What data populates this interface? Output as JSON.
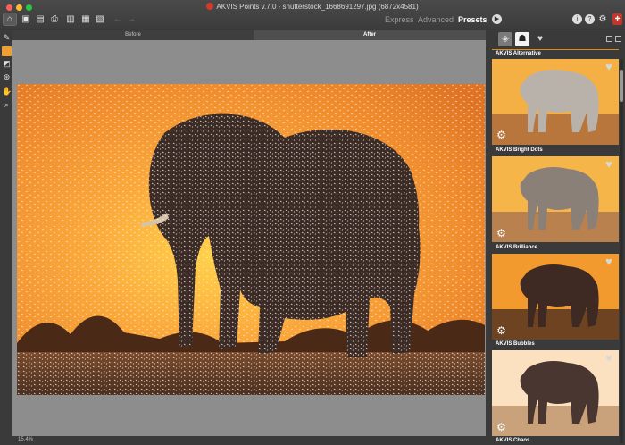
{
  "window": {
    "title": "AKVIS Points v.7.0 - shutterstock_1668691297.jpg (6872x4581)"
  },
  "toolbar": {
    "left_icons": [
      "home-icon",
      "open-file-icon",
      "save-file-icon",
      "print-icon",
      "batch-icon",
      "share-icon",
      "preferences-icon",
      "undo-icon",
      "redo-icon"
    ],
    "modes": [
      "Express",
      "Advanced",
      "Presets"
    ],
    "active_mode": "Presets",
    "right_icons": [
      "run-icon",
      "info-icon",
      "help-icon",
      "settings-icon",
      "akvis-shop-icon"
    ],
    "help_glyph": "?",
    "info_glyph": "i"
  },
  "tools": [
    "brush-tool-icon",
    "color-swatch",
    "eraser-icon",
    "stamp-icon",
    "hand-icon",
    "zoom-icon"
  ],
  "canvas": {
    "tabs": [
      "Before",
      "After"
    ],
    "active_tab": "After",
    "zoom": "15.4%"
  },
  "presets": {
    "tabs": [
      "akvis-presets-icon",
      "user-presets-icon",
      "favorites-icon"
    ],
    "items": [
      {
        "label": "AKVIS Alternative"
      },
      {
        "label": "AKVIS Bright Dots"
      },
      {
        "label": "AKVIS Brilliance"
      },
      {
        "label": "AKVIS Bubbles"
      },
      {
        "label": "AKVIS Chaos"
      }
    ]
  },
  "colors": {
    "accent": "#f0a030",
    "panel_bg": "#3a3a3a",
    "canvas_bg": "#8d8d8d",
    "shop_red": "#c4352c"
  }
}
